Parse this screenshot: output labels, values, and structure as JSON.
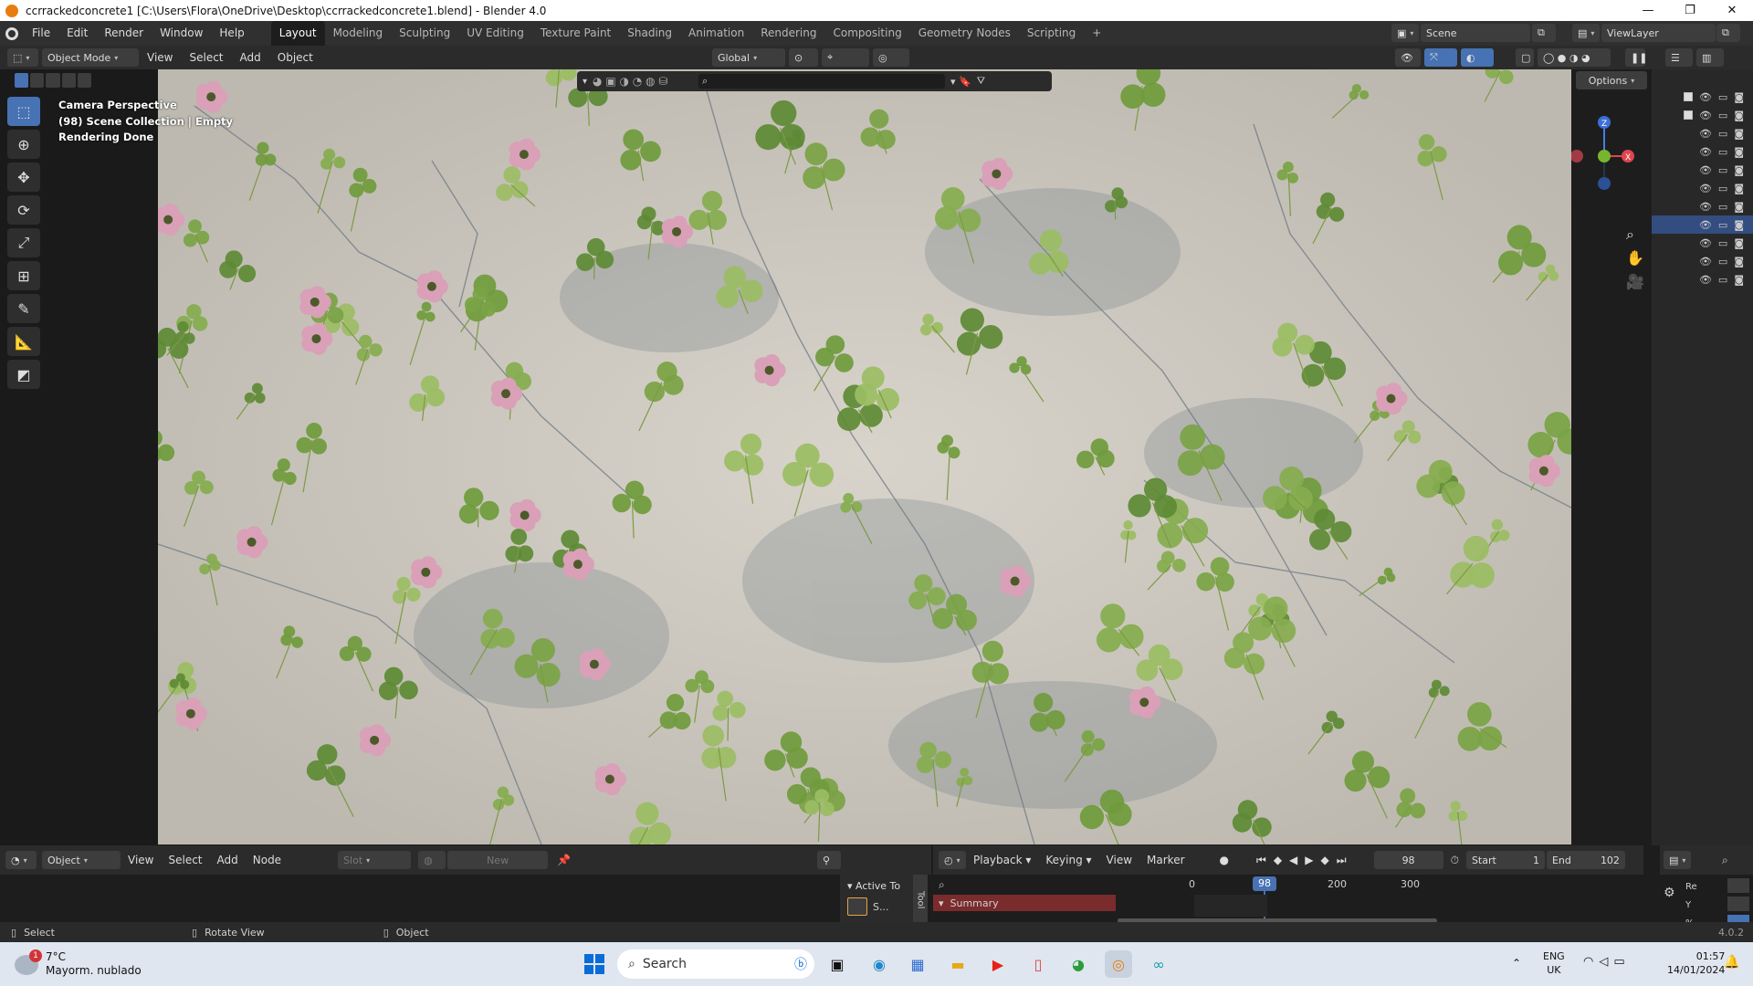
{
  "window": {
    "title": "ccrrackedconcrete1 [C:\\Users\\Flora\\OneDrive\\Desktop\\ccrrackedconcrete1.blend] - Blender 4.0",
    "minimize": "—",
    "maximize": "❐",
    "close": "✕"
  },
  "menus": [
    "File",
    "Edit",
    "Render",
    "Window",
    "Help"
  ],
  "workspaces": [
    "Layout",
    "Modeling",
    "Sculpting",
    "UV Editing",
    "Texture Paint",
    "Shading",
    "Animation",
    "Rendering",
    "Compositing",
    "Geometry Nodes",
    "Scripting"
  ],
  "active_workspace": "Layout",
  "add_workspace": "+",
  "scene": "Scene",
  "view_layer": "ViewLayer",
  "viewport": {
    "mode": "Object Mode",
    "menus": [
      "View",
      "Select",
      "Add",
      "Object"
    ],
    "orientation": "Global",
    "options": "Options",
    "overlay_lines": [
      "Camera Perspective",
      "(98) Scene Collection | Empty",
      "Rendering Done"
    ],
    "gizmo_axes": {
      "z": "Z",
      "x": "X"
    }
  },
  "tools": [
    "select-box",
    "cursor",
    "move",
    "rotate",
    "scale",
    "transform",
    "annotate",
    "measure",
    "add-cube"
  ],
  "outliner_rows": [
    {
      "checkbox": true,
      "selected": false
    },
    {
      "checkbox": true,
      "selected": false
    },
    {
      "checkbox": false,
      "selected": false
    },
    {
      "checkbox": false,
      "selected": false
    },
    {
      "checkbox": false,
      "selected": false
    },
    {
      "checkbox": false,
      "selected": false
    },
    {
      "checkbox": false,
      "selected": false
    },
    {
      "checkbox": false,
      "selected": true
    },
    {
      "checkbox": false,
      "selected": false
    },
    {
      "checkbox": false,
      "selected": false
    },
    {
      "checkbox": false,
      "selected": false
    }
  ],
  "shader_editor": {
    "mode": "Object",
    "menus": [
      "View",
      "Select",
      "Add",
      "Node"
    ],
    "slot": "Slot",
    "new": "New",
    "active_tool_label": "Active To",
    "tool_item": "S...",
    "tool_tab": "Tool"
  },
  "timeline": {
    "menus": [
      "Playback",
      "Keying",
      "View",
      "Marker"
    ],
    "current_frame": "98",
    "start_label": "Start",
    "start": "1",
    "end_label": "End",
    "end": "102",
    "summary": "Summary",
    "ruler": [
      "0",
      "98",
      "200",
      "300"
    ]
  },
  "properties_mini": [
    "Re",
    "Y",
    "%"
  ],
  "status_bar": {
    "select": "Select",
    "rotate": "Rotate View",
    "object": "Object",
    "version": "4.0.2"
  },
  "taskbar": {
    "weather_temp": "7°C",
    "weather_desc": "Mayorm. nublado",
    "weather_badge": "1",
    "search": "Search",
    "lang_top": "ENG",
    "lang_bottom": "UK",
    "time": "01:57",
    "date": "14/01/2024"
  },
  "colors": {
    "accent": "#4772b3",
    "blender_orange": "#e87d0d",
    "summary_red": "#7a2b2b"
  }
}
